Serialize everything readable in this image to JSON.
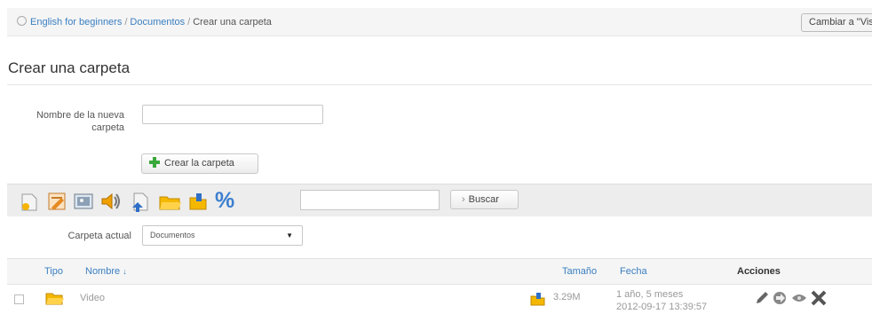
{
  "breadcrumb": {
    "items": [
      "English for beginners",
      "Documentos"
    ],
    "separator": "/",
    "current": "Crear una carpeta"
  },
  "view_toggle_label": "Cambiar a \"Vis",
  "page_title": "Crear una carpeta",
  "form": {
    "folder_name_label": "Nombre de la nueva carpeta",
    "folder_name_value": "",
    "create_button_label": "Crear la carpeta"
  },
  "toolbar": {
    "icons": [
      "new-document-icon",
      "edit-html-icon",
      "image-gallery-icon",
      "audio-icon",
      "upload-document-icon",
      "new-folder-icon",
      "folder-share-icon",
      "quota-percent-icon"
    ],
    "percent_glyph": "%",
    "search_value": "",
    "search_button_label": "Buscar",
    "search_button_arrow": "›"
  },
  "current_folder": {
    "label": "Carpeta actual",
    "selected": "Documentos"
  },
  "table": {
    "columns": {
      "type": "Tipo",
      "name": "Nombre",
      "name_sort_arrow": "↓",
      "size": "Tamaño",
      "date": "Fecha",
      "actions": "Acciones"
    },
    "rows": [
      {
        "name": "Video",
        "size": "3.29M",
        "date_relative": "1 año, 5 meses",
        "date_absolute": "2012-09-17 13:39:57"
      }
    ]
  },
  "colors": {
    "link": "#3a7fc1",
    "folder": "#f0b400",
    "bar_background": "#ededed"
  }
}
